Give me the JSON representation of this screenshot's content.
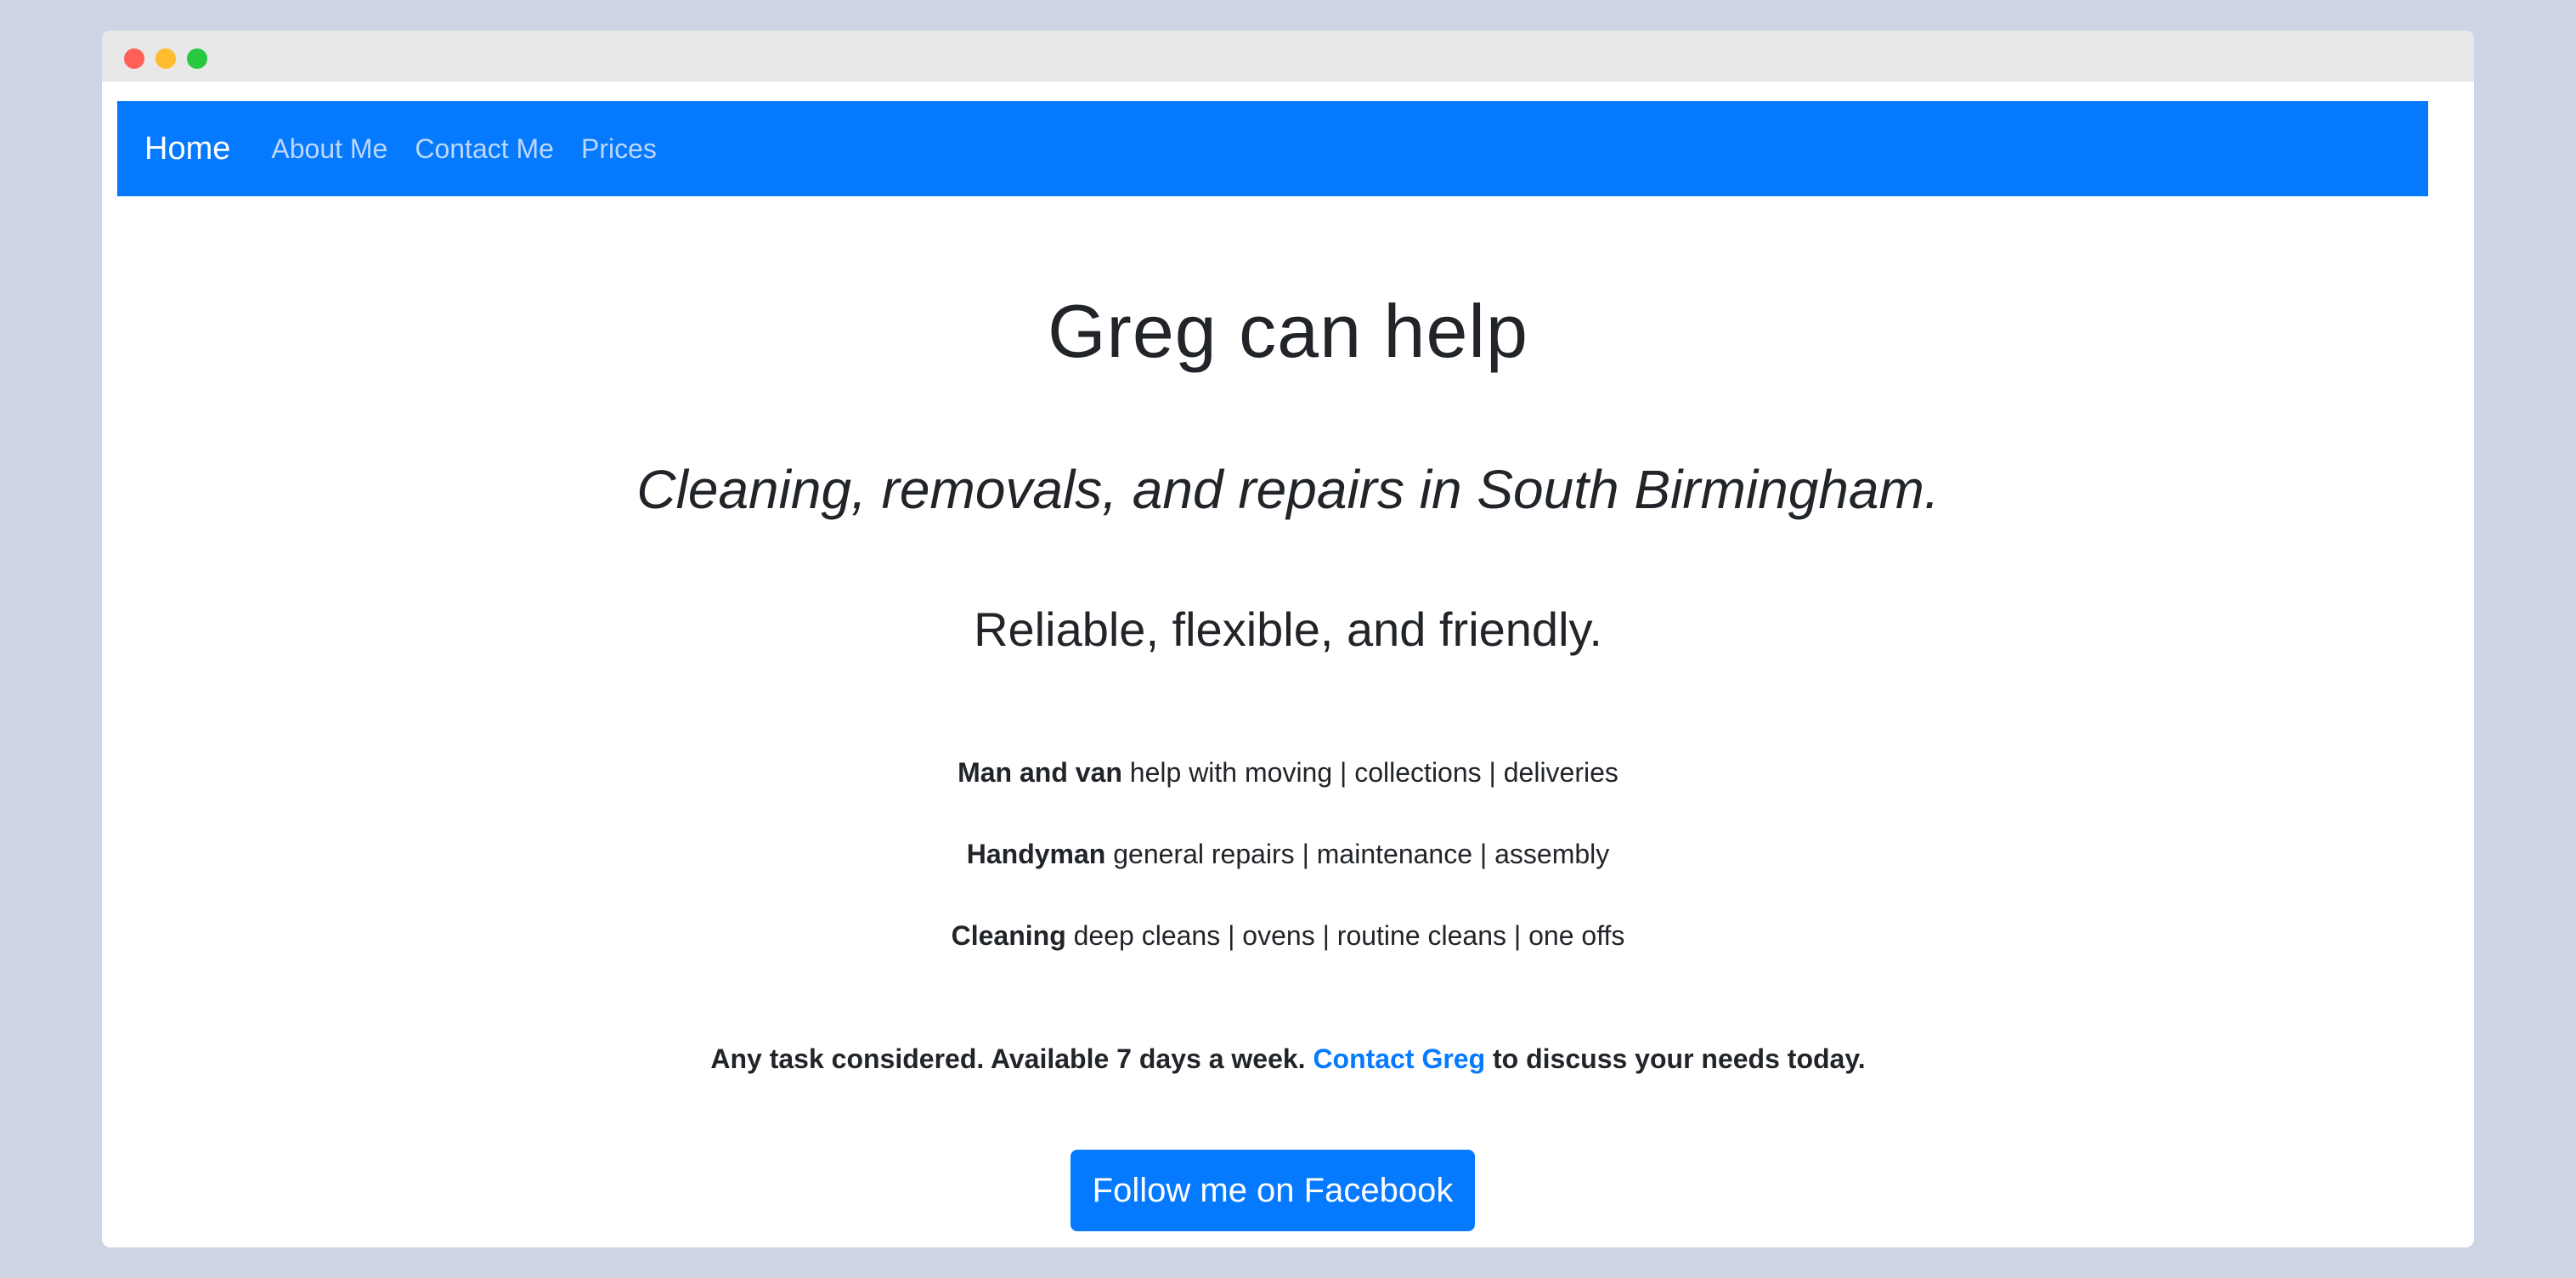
{
  "colors": {
    "brand_blue": "#057aff",
    "nav_link": "#bcd8ff",
    "text": "#212529",
    "link": "#057aff"
  },
  "navbar": {
    "brand": "Home",
    "links": [
      "About Me",
      "Contact Me",
      "Prices"
    ]
  },
  "hero": {
    "title": "Greg can help",
    "tagline": "Cleaning, removals, and repairs in South Birmingham.",
    "subtag": "Reliable, flexible, and friendly."
  },
  "services": [
    {
      "name": "Man and van",
      "detail": " help with moving | collections | deliveries"
    },
    {
      "name": "Handyman",
      "detail": " general repairs | maintenance | assembly"
    },
    {
      "name": "Cleaning",
      "detail": " deep cleans | ovens | routine cleans | one offs"
    }
  ],
  "cta": {
    "before": "Any task considered. Available 7 days a week. ",
    "link_text": "Contact Greg",
    "after": " to discuss your needs today."
  },
  "facebook_button": "Follow me on Facebook"
}
